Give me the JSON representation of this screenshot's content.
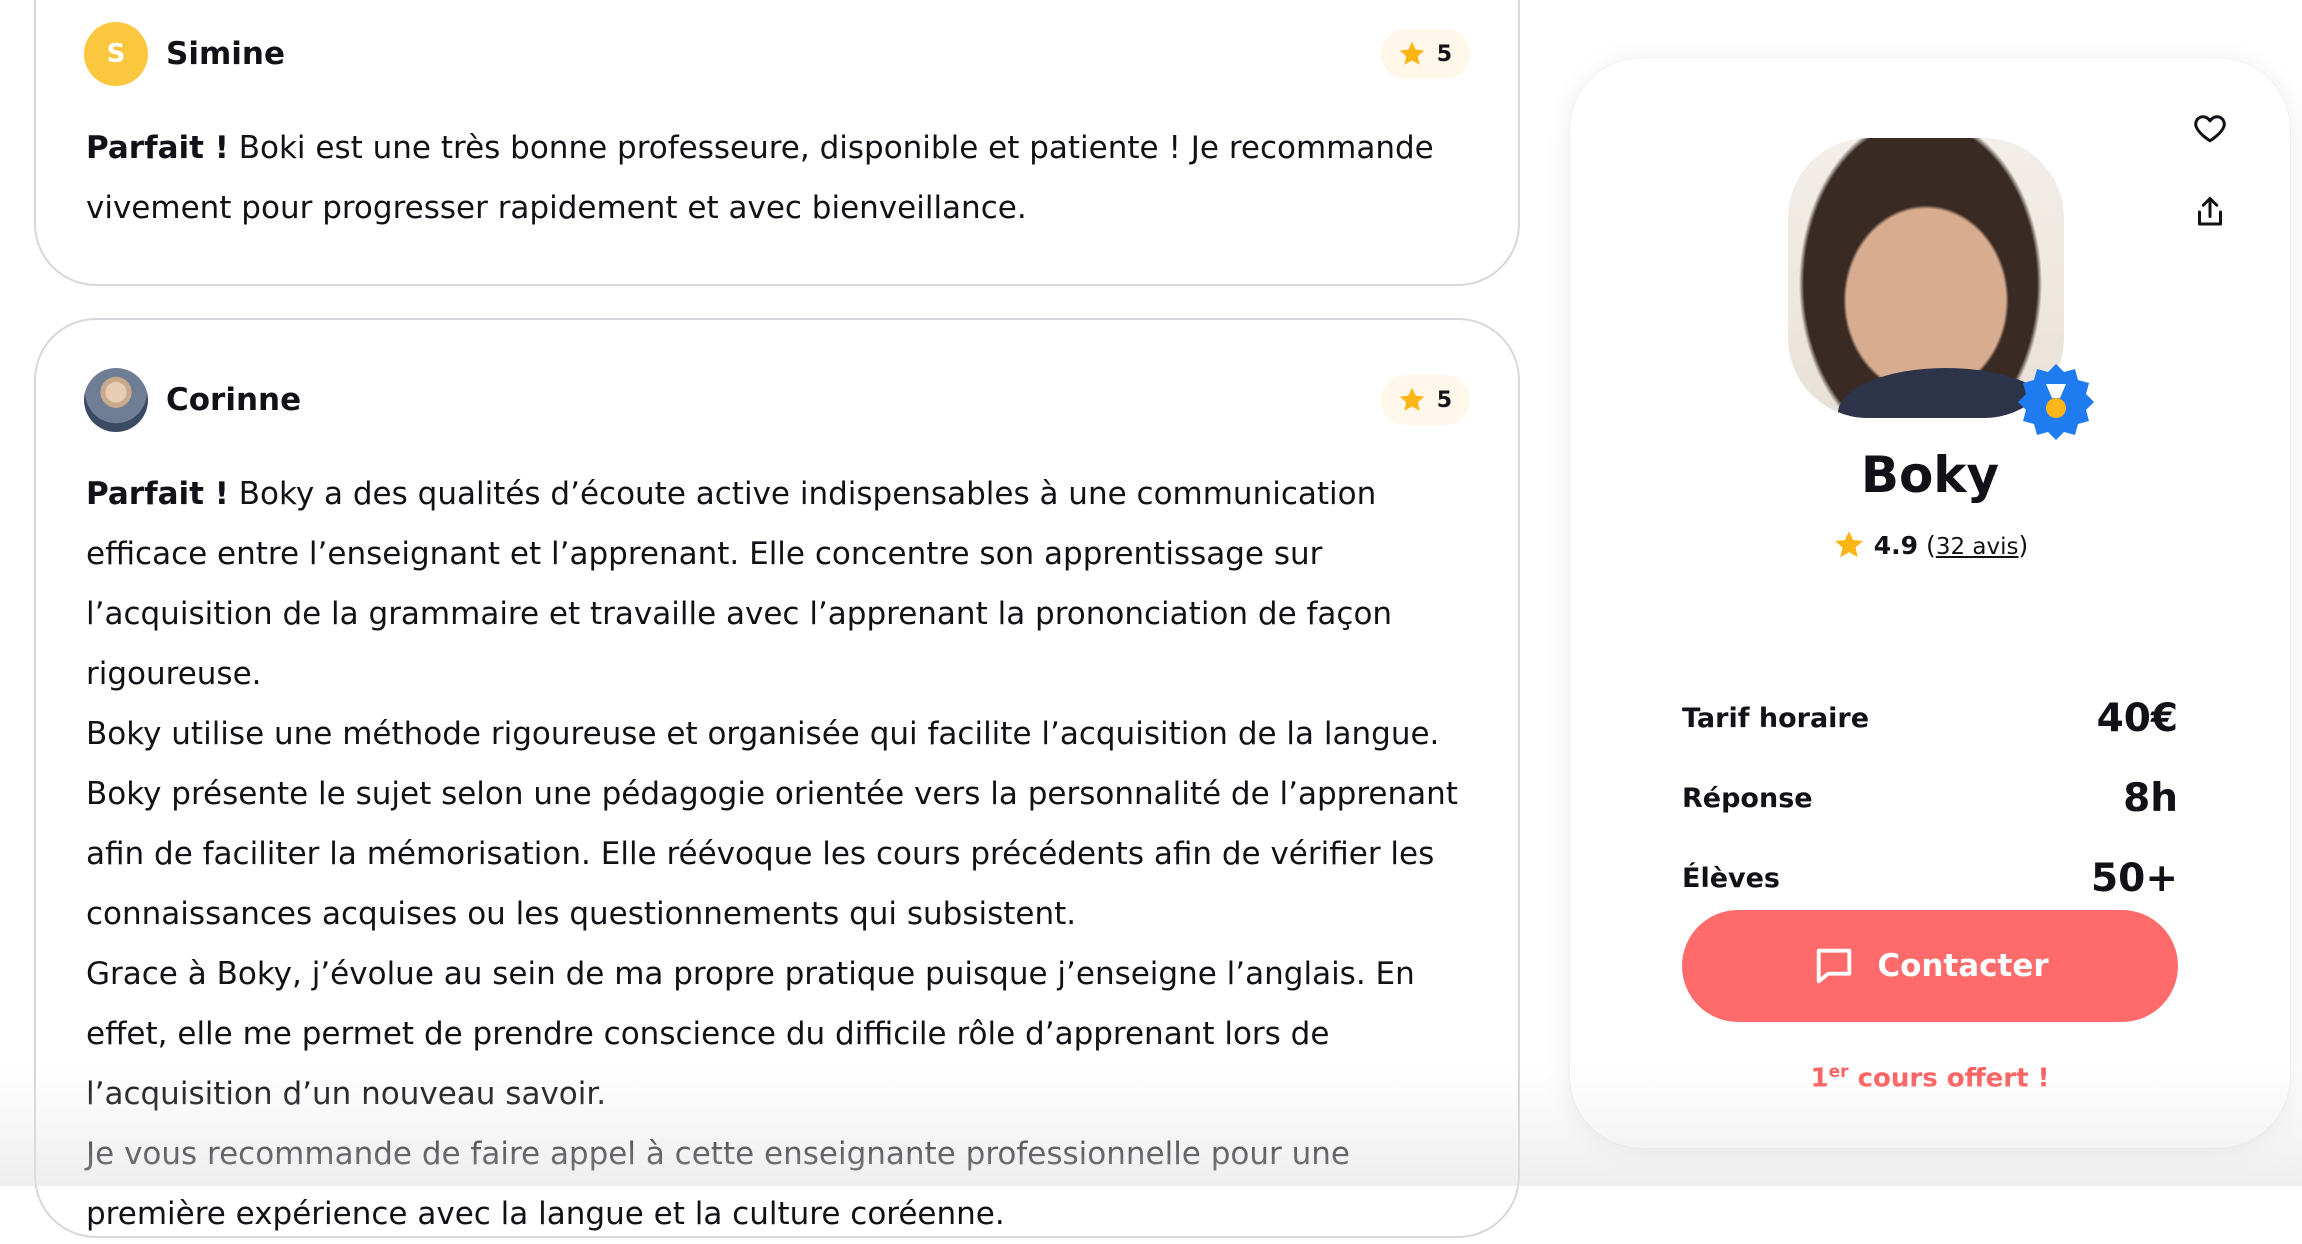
{
  "reviews": [
    {
      "avatar_letter": "S",
      "name": "Simine",
      "rating": "5",
      "headline": "Parfait !",
      "paragraphs": [
        "Boki est une très bonne professeure, disponible et patiente ! Je recommande vivement pour progresser rapidement et avec bienveillance."
      ]
    },
    {
      "name": "Corinne",
      "rating": "5",
      "headline": "Parfait !",
      "paragraphs": [
        "Boky a des qualités d’écoute active indispensables à une communication efficace entre l’enseignant et l’apprenant. Elle concentre son apprentissage sur l’acquisition de la grammaire et travaille avec l’apprenant la prononciation de façon rigoureuse.",
        "Boky utilise une méthode rigoureuse et organisée qui facilite l’acquisition de la langue.",
        "Boky présente le sujet selon une pédagogie orientée vers la personnalité de l’apprenant afin de faciliter la mémorisation. Elle réévoque les cours précédents afin de vérifier les connaissances acquises ou les questionnements qui subsistent.",
        "Grace à Boky, j’évolue au sein de ma propre pratique puisque j’enseigne l’anglais. En effet, elle me permet de prendre conscience du difficile rôle d’apprenant lors de l’acquisition d’un nouveau savoir.",
        "Je vous recommande de faire appel à cette enseignante professionnelle pour une première expérience avec la langue et la culture coréenne."
      ]
    }
  ],
  "profile": {
    "name": "Boky",
    "rating": "4.9",
    "reviews_link": "32 avis",
    "stats": [
      {
        "label": "Tarif horaire",
        "value": "40€"
      },
      {
        "label": "Réponse",
        "value": "8h"
      },
      {
        "label": "Élèves",
        "value": "50+"
      }
    ],
    "contact_label": "Contacter",
    "offer_prefix": "1",
    "offer_sup": "er",
    "offer_text": " cours offert !"
  },
  "colors": {
    "accent": "#ff6b6b",
    "star": "#fdb515",
    "avatar_yellow": "#fbc73f",
    "badge_blue": "#1e7bf0"
  },
  "icons": [
    "star-icon",
    "heart-icon",
    "share-icon",
    "chat-bubble-icon",
    "medal-badge-icon"
  ]
}
